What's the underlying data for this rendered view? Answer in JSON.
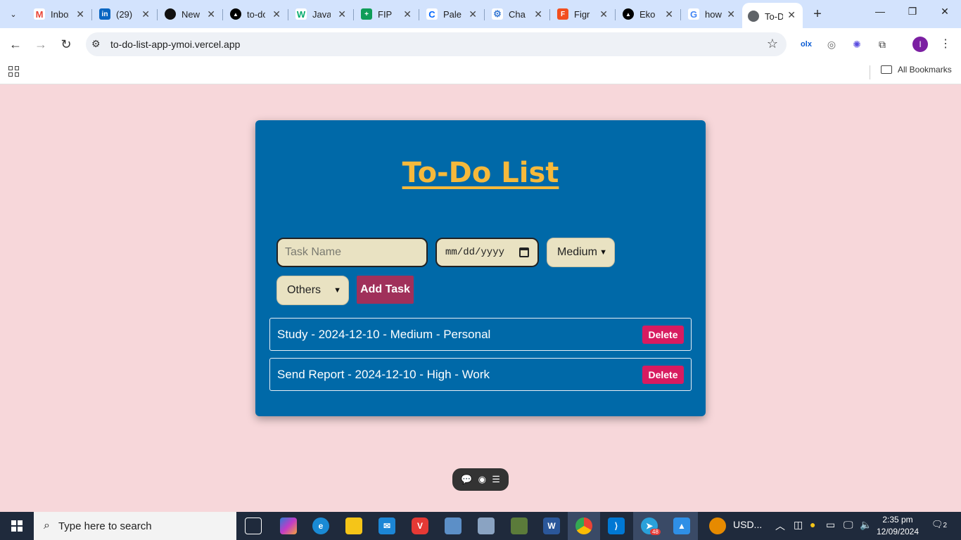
{
  "browser": {
    "tabs": [
      {
        "title": "Inbox",
        "icon": "gmail-icon",
        "color": "#ea4335",
        "glyph": "M"
      },
      {
        "title": "(29)",
        "icon": "linkedin-icon",
        "color": "#0a66c2",
        "glyph": "in"
      },
      {
        "title": "New",
        "icon": "github-icon",
        "color": "#111111",
        "glyph": "●"
      },
      {
        "title": "to-do",
        "icon": "vercel-icon",
        "color": "#000000",
        "glyph": "▲"
      },
      {
        "title": "Java",
        "icon": "w3-icon",
        "color": "#04aa6d",
        "glyph": "W"
      },
      {
        "title": "FIP",
        "icon": "sheets-icon",
        "color": "#0f9d58",
        "glyph": "+"
      },
      {
        "title": "Pale",
        "icon": "coolors-icon",
        "color": "#0066ff",
        "glyph": "C"
      },
      {
        "title": "Cha",
        "icon": "chatgpt-icon",
        "color": "#3a7bd5",
        "glyph": "⚙"
      },
      {
        "title": "Figr",
        "icon": "figma-icon",
        "color": "#f24e1e",
        "glyph": "F"
      },
      {
        "title": "Eko",
        "icon": "vercel-icon",
        "color": "#000000",
        "glyph": "▲"
      },
      {
        "title": "how",
        "icon": "google-icon",
        "color": "#4285f4",
        "glyph": "G"
      },
      {
        "title": "To-D",
        "icon": "globe-icon",
        "color": "#5f6368",
        "glyph": "◍"
      }
    ],
    "url": "to-do-list-app-ymoi.vercel.app",
    "bookmarks_label": "All Bookmarks",
    "avatar_letter": "I"
  },
  "app": {
    "title": "To-Do List",
    "task_placeholder": "Task Name",
    "date_placeholder": "mm/dd/yyyy",
    "priority_selected": "Medium",
    "category_selected": "Others",
    "add_button": "Add Task",
    "tasks": [
      {
        "text": "Study - 2024-12-10 - Medium - Personal",
        "delete_label": "Delete"
      },
      {
        "text": "Send Report - 2024-12-10 - High - Work",
        "delete_label": "Delete"
      }
    ],
    "colors": {
      "background": "#f7d7da",
      "card": "#0069a8",
      "title": "#f6b93b",
      "input": "#e9e2c2",
      "add_button": "#a0305a",
      "delete_button": "#d81b60"
    }
  },
  "taskbar": {
    "search_placeholder": "Type here to search",
    "weather_text": "USD...",
    "time": "2:35 pm",
    "date": "12/09/2024",
    "notification_count": "2",
    "telegram_badge": "48"
  }
}
